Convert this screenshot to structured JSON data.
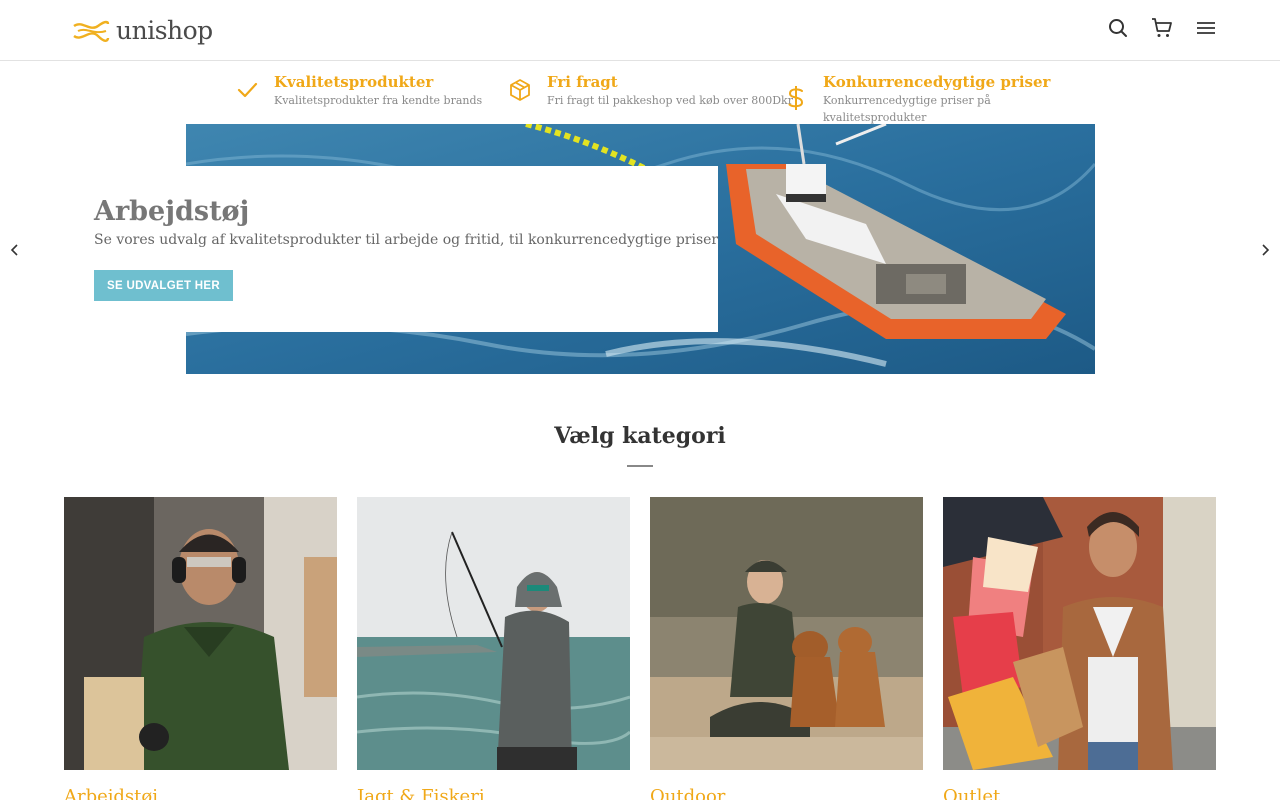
{
  "header": {
    "logo_text": "unishop",
    "icons": [
      "search-icon",
      "cart-icon",
      "menu-icon"
    ]
  },
  "usps": [
    {
      "icon": "check-icon",
      "title": "Kvalitetsprodukter",
      "subtitle": "Kvalitetsprodukter fra kendte brands"
    },
    {
      "icon": "box-icon",
      "title": "Fri fragt",
      "subtitle": "Fri fragt til pakkeshop ved køb over 800Dkr"
    },
    {
      "icon": "dollar-icon",
      "title": "Konkurrencedygtige priser",
      "subtitle_line1": "Konkurrencedygtige priser på",
      "subtitle_line2": "kvalitetsprodukter"
    }
  ],
  "hero": {
    "title": "Arbejdstøj",
    "text": "Se vores udvalg af kvalitetsprodukter til arbejde og fritid, til konkurrencedygtige priser",
    "button": "SE UDVALGET HER"
  },
  "section": {
    "title": "Vælg kategori"
  },
  "categories": [
    {
      "label": "Arbejdstøj"
    },
    {
      "label": "Jagt & Fiskeri"
    },
    {
      "label": "Outdoor"
    },
    {
      "label": "Outlet"
    }
  ],
  "colors": {
    "accent": "#f0a818",
    "button": "#6fbfcf"
  }
}
